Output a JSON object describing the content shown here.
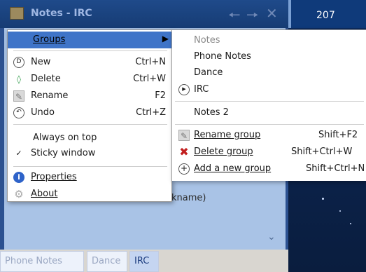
{
  "window": {
    "title": "Notes - IRC",
    "back_icon": "back-arrow-icon",
    "forward_icon": "forward-arrow-icon",
    "close_icon": "close-icon"
  },
  "desktop": {
    "number": "207"
  },
  "note": {
    "text_fragment": "kname)",
    "tabs": [
      {
        "label": "Phone Notes"
      },
      {
        "label": "Dance"
      },
      {
        "label": "IRC"
      }
    ]
  },
  "menu": {
    "groups": "Groups",
    "items": [
      {
        "label": "New",
        "shortcut": "Ctrl+N",
        "icon": "new-note-icon"
      },
      {
        "label": "Delete",
        "shortcut": "Ctrl+W",
        "icon": "delete-note-icon"
      },
      {
        "label": "Rename",
        "shortcut": "F2",
        "icon": "rename-icon"
      },
      {
        "label": "Undo",
        "shortcut": "Ctrl+Z",
        "icon": "undo-icon"
      }
    ],
    "always_on_top": "Always on top",
    "sticky_window": "Sticky window",
    "properties": "Properties",
    "about": "About"
  },
  "submenu": {
    "header": "Notes",
    "groups": [
      "Phone Notes",
      "Dance",
      "IRC"
    ],
    "notes2": "Notes 2",
    "actions": [
      {
        "label": "Rename group",
        "shortcut": "Shift+F2",
        "icon": "rename-icon"
      },
      {
        "label": "Delete group",
        "shortcut": "Shift+Ctrl+W",
        "icon": "delete-x-icon"
      },
      {
        "label": "Add a new group",
        "shortcut": "Shift+Ctrl+N",
        "icon": "add-icon"
      }
    ]
  },
  "colors": {
    "menu_highlight": "#3f74c8",
    "note_background": "#a9c3e6",
    "titlebar": "#1f4a8a"
  }
}
